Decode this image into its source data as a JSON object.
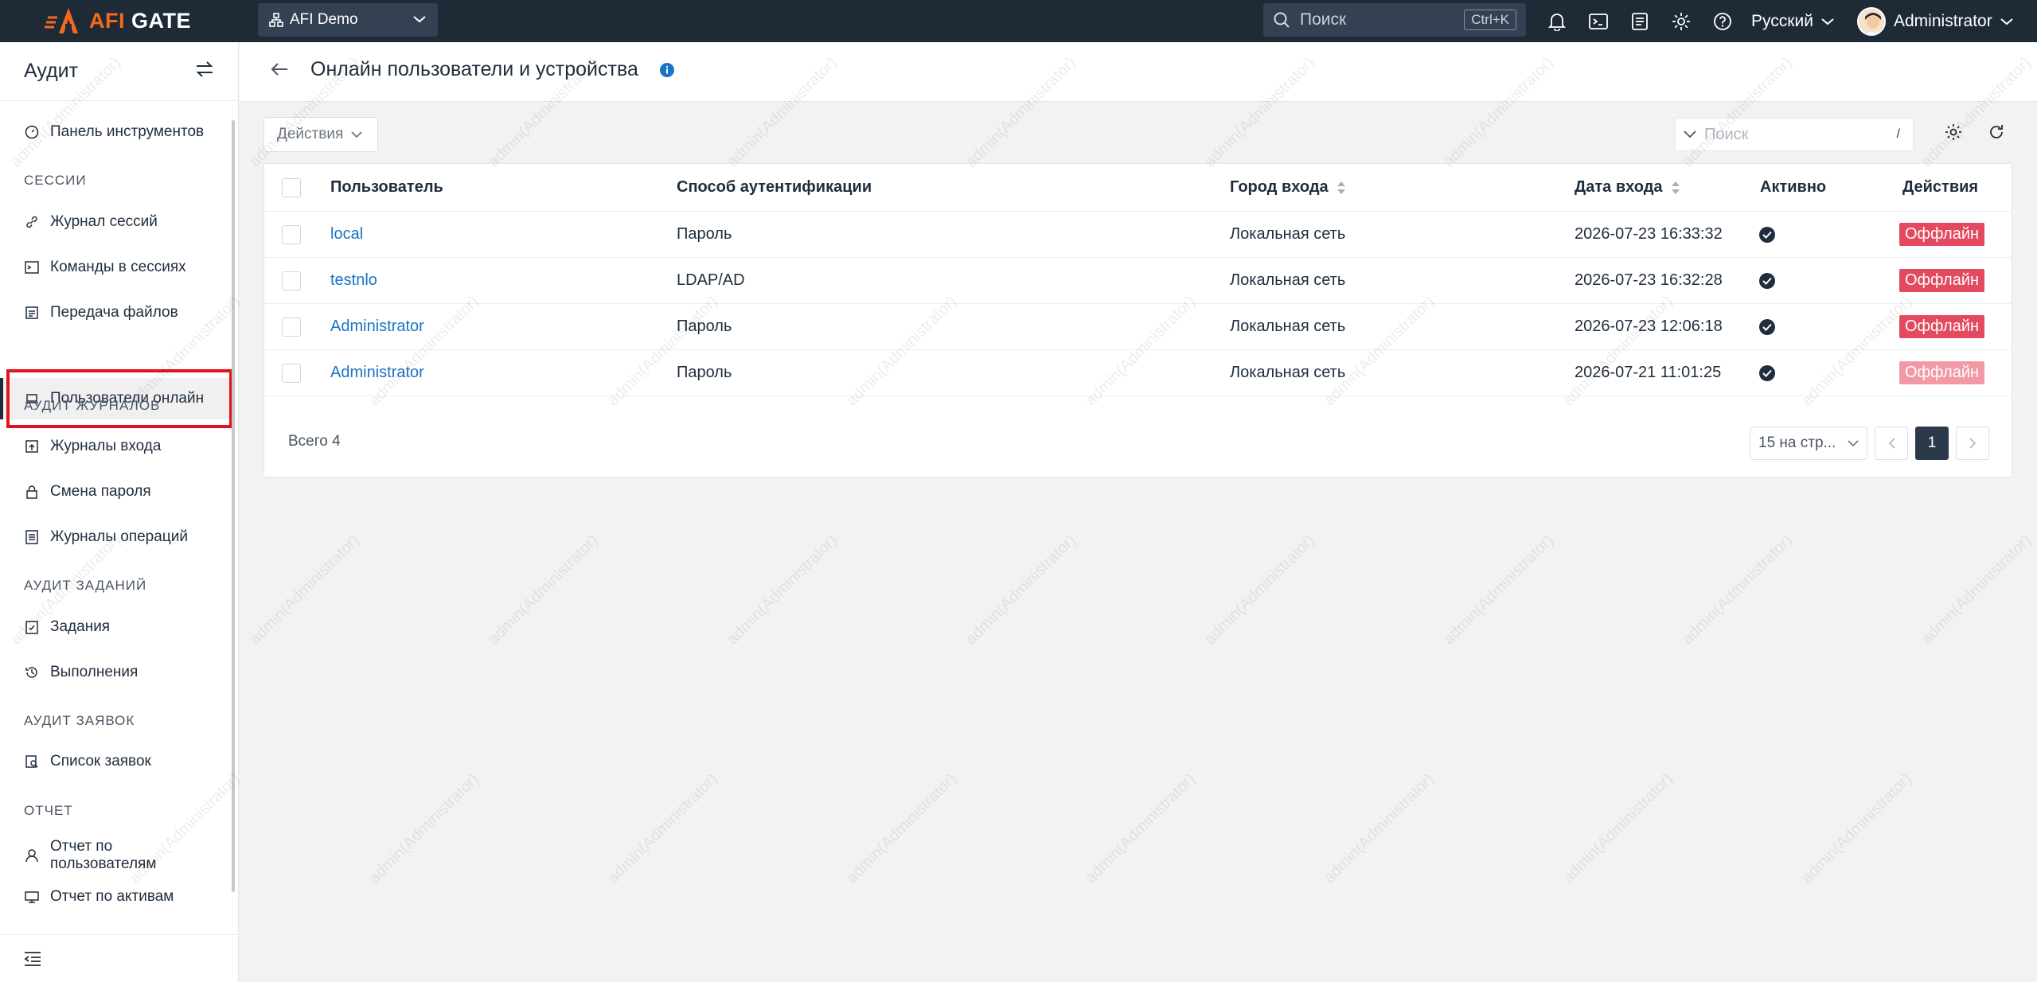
{
  "topbar": {
    "brand_prefix": "AFI",
    "brand_suffix": "GATE",
    "org": "AFI Demo",
    "search_placeholder": "Поиск",
    "search_shortcut": "Ctrl+K",
    "language": "Русский",
    "user": "Administrator"
  },
  "sidebar": {
    "title": "Аудит",
    "items": {
      "dashboard": "Панель инструментов",
      "sessions_section": "СЕССИИ",
      "session_log": "Журнал сессий",
      "session_commands": "Команды в сессиях",
      "file_transfer": "Передача файлов",
      "online_users": "Пользователи онлайн",
      "log_audit_section": "АУДИТ ЖУРНАЛОВ",
      "login_logs": "Журналы входа",
      "password_change": "Смена пароля",
      "operation_logs": "Журналы операций",
      "task_audit_section": "АУДИТ ЗАДАНИЙ",
      "tasks": "Задания",
      "executions": "Выполнения",
      "ticket_audit_section": "АУДИТ ЗАЯВОК",
      "ticket_list": "Список заявок",
      "report_section": "ОТЧЕТ",
      "user_report": "Отчет по пользователям",
      "asset_report": "Отчет по активам"
    }
  },
  "page": {
    "title": "Онлайн пользователи и устройства",
    "actions_label": "Действия",
    "search_placeholder": "Поиск",
    "search_shortcut": "/"
  },
  "table": {
    "columns": {
      "user": "Пользователь",
      "auth_method": "Способ аутентификации",
      "login_city": "Город входа",
      "login_date": "Дата входа",
      "active": "Активно",
      "actions": "Действия"
    },
    "rows": [
      {
        "user": "local",
        "auth_method": "Пароль",
        "login_city": "Локальная сеть",
        "login_date": "2026-07-23 16:33:32",
        "status": "Оффлайн"
      },
      {
        "user": "testnlo",
        "auth_method": "LDAP/AD",
        "login_city": "Локальная сеть",
        "login_date": "2026-07-23 16:32:28",
        "status": "Оффлайн"
      },
      {
        "user": "Administrator",
        "auth_method": "Пароль",
        "login_city": "Локальная сеть",
        "login_date": "2026-07-23 12:06:18",
        "status": "Оффлайн"
      },
      {
        "user": "Administrator",
        "auth_method": "Пароль",
        "login_city": "Локальная сеть",
        "login_date": "2026-07-21 11:01:25",
        "status": "Оффлайн"
      }
    ]
  },
  "pagination": {
    "total_label": "Всего 4",
    "page_size": "15 на стр...",
    "current_page": "1"
  },
  "watermark": "admin(Administrator)",
  "colors": {
    "topbar": "#1f2a37",
    "brand_orange": "#f26b1d",
    "link": "#1b73c7",
    "offline_badge": "#e34a5f",
    "highlight": "#e0141e"
  }
}
